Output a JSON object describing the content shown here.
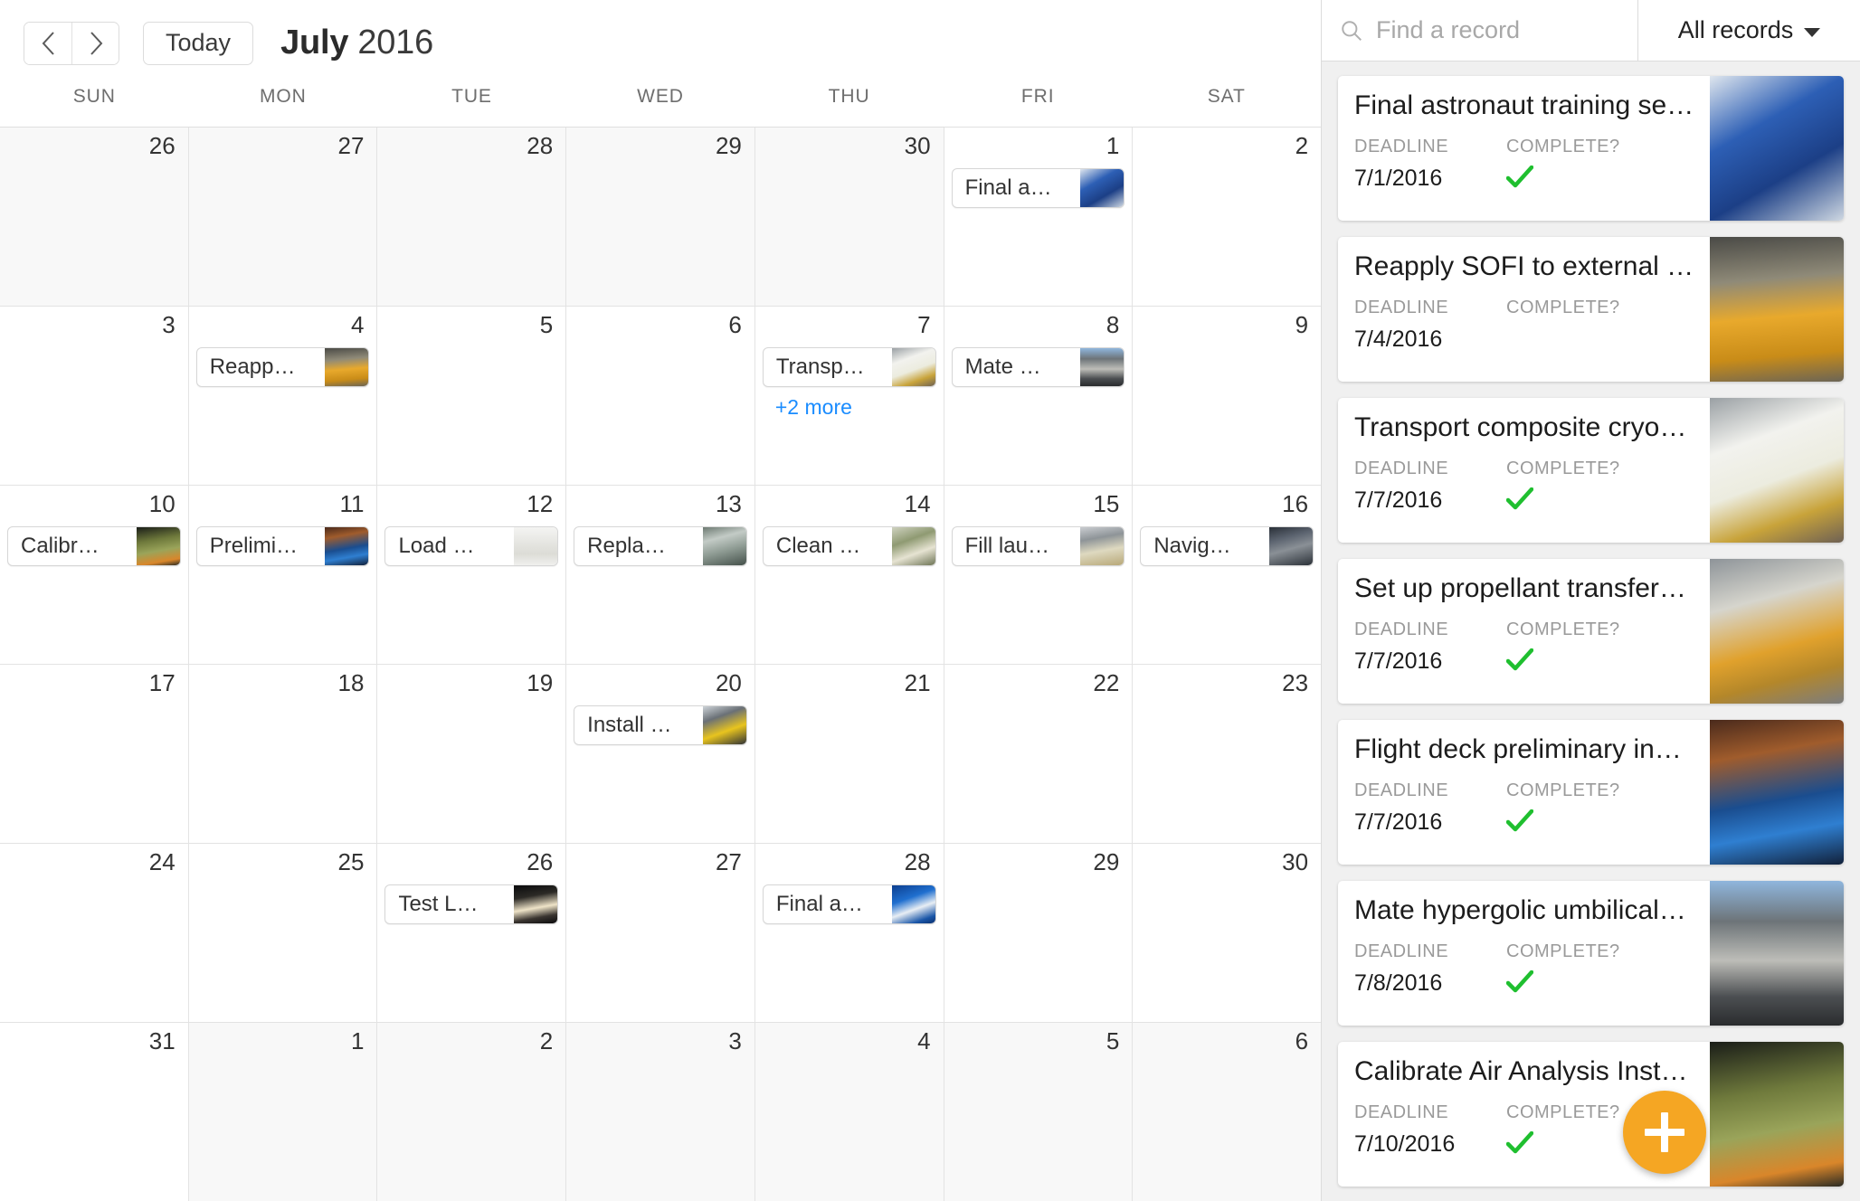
{
  "toolbar": {
    "prev_label": "‹",
    "next_label": "›",
    "today_label": "Today",
    "month": "July",
    "year": "2016"
  },
  "calendar": {
    "day_headers": [
      "SUN",
      "MON",
      "TUE",
      "WED",
      "THU",
      "FRI",
      "SAT"
    ],
    "weeks": [
      [
        {
          "num": "26",
          "other": true,
          "events": []
        },
        {
          "num": "27",
          "other": true,
          "events": []
        },
        {
          "num": "28",
          "other": true,
          "events": []
        },
        {
          "num": "29",
          "other": true,
          "events": []
        },
        {
          "num": "30",
          "other": true,
          "events": []
        },
        {
          "num": "1",
          "other": false,
          "events": [
            {
              "label": "Final a…",
              "thumb": "astronauts"
            }
          ]
        },
        {
          "num": "2",
          "other": false,
          "events": []
        }
      ],
      [
        {
          "num": "3",
          "other": false,
          "events": []
        },
        {
          "num": "4",
          "other": false,
          "events": [
            {
              "label": "Reapp…",
              "thumb": "sofi-tank"
            }
          ]
        },
        {
          "num": "5",
          "other": false,
          "events": []
        },
        {
          "num": "6",
          "other": false,
          "events": []
        },
        {
          "num": "7",
          "other": false,
          "events": [
            {
              "label": "Transp…",
              "thumb": "cryo-tank"
            }
          ],
          "more": "+2 more"
        },
        {
          "num": "8",
          "other": false,
          "events": [
            {
              "label": "Mate …",
              "thumb": "umbilical"
            }
          ]
        },
        {
          "num": "9",
          "other": false,
          "events": []
        }
      ],
      [
        {
          "num": "10",
          "other": false,
          "events": [
            {
              "label": "Calibr…",
              "thumb": "air-analysis"
            }
          ]
        },
        {
          "num": "11",
          "other": false,
          "events": [
            {
              "label": "Prelimi…",
              "thumb": "flight-deck"
            }
          ]
        },
        {
          "num": "12",
          "other": false,
          "events": [
            {
              "label": "Load …",
              "thumb": "documents"
            }
          ]
        },
        {
          "num": "13",
          "other": false,
          "events": [
            {
              "label": "Repla…",
              "thumb": "canisters"
            }
          ]
        },
        {
          "num": "14",
          "other": false,
          "events": [
            {
              "label": "Clean …",
              "thumb": "cleaning"
            }
          ]
        },
        {
          "num": "15",
          "other": false,
          "events": [
            {
              "label": "Fill lau…",
              "thumb": "launch-pad"
            }
          ]
        },
        {
          "num": "16",
          "other": false,
          "events": [
            {
              "label": "Navig…",
              "thumb": "navigation"
            }
          ]
        }
      ],
      [
        {
          "num": "17",
          "other": false,
          "events": []
        },
        {
          "num": "18",
          "other": false,
          "events": []
        },
        {
          "num": "19",
          "other": false,
          "events": []
        },
        {
          "num": "20",
          "other": false,
          "events": [
            {
              "label": "Install …",
              "thumb": "install"
            }
          ]
        },
        {
          "num": "21",
          "other": false,
          "events": []
        },
        {
          "num": "22",
          "other": false,
          "events": []
        },
        {
          "num": "23",
          "other": false,
          "events": []
        }
      ],
      [
        {
          "num": "24",
          "other": false,
          "events": []
        },
        {
          "num": "25",
          "other": false,
          "events": []
        },
        {
          "num": "26",
          "other": false,
          "events": [
            {
              "label": "Test L…",
              "thumb": "night-launch"
            }
          ]
        },
        {
          "num": "27",
          "other": false,
          "events": []
        },
        {
          "num": "28",
          "other": false,
          "events": [
            {
              "label": "Final a…",
              "thumb": "earth"
            }
          ]
        },
        {
          "num": "29",
          "other": false,
          "events": []
        },
        {
          "num": "30",
          "other": false,
          "events": []
        }
      ],
      [
        {
          "num": "31",
          "other": false,
          "events": []
        },
        {
          "num": "1",
          "other": true,
          "events": []
        },
        {
          "num": "2",
          "other": true,
          "events": []
        },
        {
          "num": "3",
          "other": true,
          "events": []
        },
        {
          "num": "4",
          "other": true,
          "events": []
        },
        {
          "num": "5",
          "other": true,
          "events": []
        },
        {
          "num": "6",
          "other": true,
          "events": []
        }
      ]
    ]
  },
  "sidebar": {
    "search": {
      "placeholder": "Find a record",
      "value": ""
    },
    "filter_label": "All records",
    "field_labels": {
      "deadline": "DEADLINE",
      "complete": "COMPLETE?"
    },
    "records": [
      {
        "title": "Final astronaut training se…",
        "deadline": "7/1/2016",
        "complete": true,
        "thumb": "astronauts"
      },
      {
        "title": "Reapply SOFI to external …",
        "deadline": "7/4/2016",
        "complete": false,
        "thumb": "sofi-tank"
      },
      {
        "title": "Transport composite cryo…",
        "deadline": "7/7/2016",
        "complete": true,
        "thumb": "cryo-tank"
      },
      {
        "title": "Set up propellant transfer…",
        "deadline": "7/7/2016",
        "complete": true,
        "thumb": "orbiter"
      },
      {
        "title": "Flight deck preliminary in…",
        "deadline": "7/7/2016",
        "complete": true,
        "thumb": "flight-deck"
      },
      {
        "title": "Mate hypergolic umbilical…",
        "deadline": "7/8/2016",
        "complete": true,
        "thumb": "umbilical"
      },
      {
        "title": "Calibrate Air Analysis Inst…",
        "deadline": "7/10/2016",
        "complete": true,
        "thumb": "air-analysis"
      }
    ],
    "add_button_label": "+"
  },
  "colors": {
    "accent_orange": "#f5a623",
    "link_blue": "#1a8cff",
    "check_green": "#1fbf2f",
    "other_month_bg": "#f8f8f8"
  }
}
